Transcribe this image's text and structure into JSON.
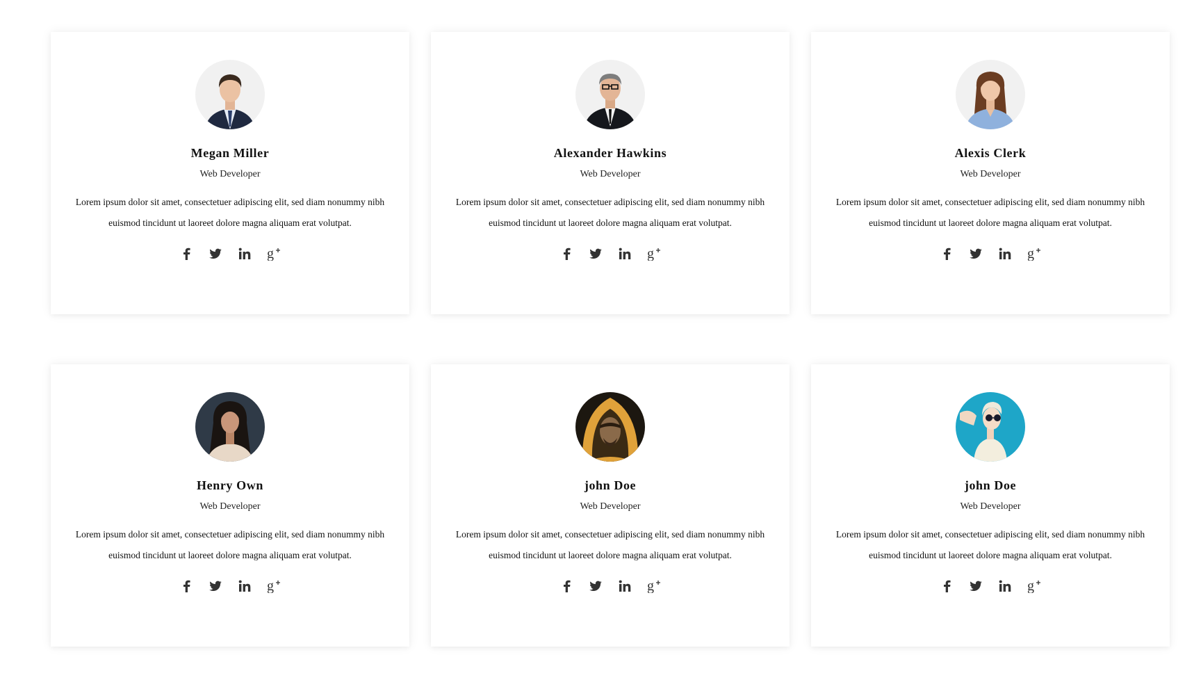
{
  "colors": {
    "card_bg": "#ffffff",
    "text": "#111111",
    "icon": "#333333"
  },
  "icons": [
    "facebook-icon",
    "twitter-icon",
    "linkedin-icon",
    "google-plus-icon"
  ],
  "members": [
    {
      "name": "Megan Miller",
      "role": "Web Developer",
      "bio": "Lorem ipsum dolor sit amet, consectetuer adipiscing elit, sed diam nonummy nibh euismod tincidunt ut laoreet dolore magna aliquam erat volutpat."
    },
    {
      "name": "Alexander Hawkins",
      "role": "Web Developer",
      "bio": "Lorem ipsum dolor sit amet, consectetuer adipiscing elit, sed diam nonummy nibh euismod tincidunt ut laoreet dolore magna aliquam erat volutpat."
    },
    {
      "name": "Alexis Clerk",
      "role": "Web Developer",
      "bio": "Lorem ipsum dolor sit amet, consectetuer adipiscing elit, sed diam nonummy nibh euismod tincidunt ut laoreet dolore magna aliquam erat volutpat."
    },
    {
      "name": "Henry Own",
      "role": "Web Developer",
      "bio": "Lorem ipsum dolor sit amet, consectetuer adipiscing elit, sed diam nonummy nibh euismod tincidunt ut laoreet dolore magna aliquam erat volutpat."
    },
    {
      "name": "john Doe",
      "role": "Web Developer",
      "bio": "Lorem ipsum dolor sit amet, consectetuer adipiscing elit, sed diam nonummy nibh euismod tincidunt ut laoreet dolore magna aliquam erat volutpat."
    },
    {
      "name": "john Doe",
      "role": "Web Developer",
      "bio": "Lorem ipsum dolor sit amet, consectetuer adipiscing elit, sed diam nonummy nibh euismod tincidunt ut laoreet dolore magna aliquam erat volutpat."
    }
  ]
}
